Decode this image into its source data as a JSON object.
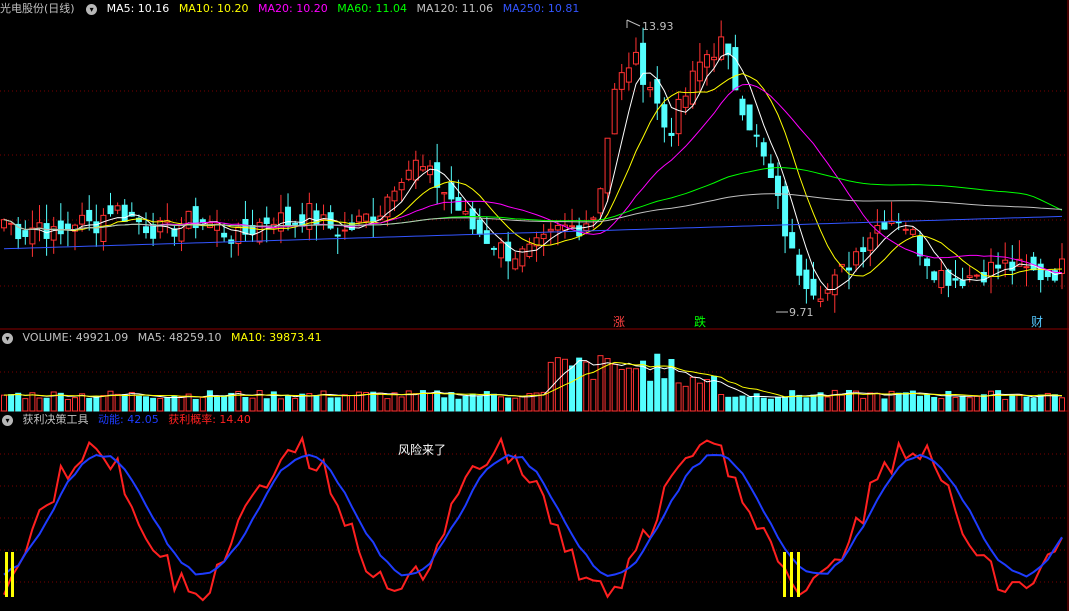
{
  "price_panel": {
    "title": "光电股份(日线)",
    "indicators": [
      {
        "label": "MA5: 10.16",
        "color": "#ffffff"
      },
      {
        "label": "MA10: 10.20",
        "color": "#ffff00"
      },
      {
        "label": "MA20: 10.20",
        "color": "#ff00ff"
      },
      {
        "label": "MA60: 11.04",
        "color": "#00ff00"
      },
      {
        "label": "MA120: 11.06",
        "color": "#c0c0c0"
      },
      {
        "label": "MA250: 10.81",
        "color": "#3355ff"
      }
    ],
    "high_label": "13.93",
    "low_label": "9.71",
    "markers": [
      "涨",
      "跌",
      "财"
    ]
  },
  "volume_panel": {
    "title": "VOLUME: 49921.09",
    "ma5": "MA5: 48259.10",
    "ma10": "MA10: 39873.41"
  },
  "indicator_panel": {
    "title": "获利决策工具",
    "momentum": "动能: 42.05",
    "probability": "获利概率: 14.40",
    "annotation": "风险来了"
  },
  "colors": {
    "up": "#ff3232",
    "down": "#54ffff",
    "ma5": "#ffffff",
    "ma10": "#ffff00",
    "ma20": "#ff00ff",
    "ma60": "#00ff00",
    "ma120": "#c0c0c0",
    "ma250": "#3355ff",
    "momentum": "#1e3cff",
    "probability": "#ff2020",
    "grid": "#8b0000"
  },
  "chart_data": {
    "type": "candlestick",
    "high": 13.93,
    "low": 9.71,
    "close_path": [
      10.9,
      10.7,
      10.85,
      10.6,
      10.9,
      10.8,
      11.1,
      10.95,
      10.8,
      10.7,
      10.85,
      10.9,
      10.75,
      10.6,
      10.8,
      10.95,
      10.85,
      11.0,
      10.8,
      10.7,
      10.9,
      11.05,
      11.6,
      11.75,
      11.5,
      11.2,
      10.8,
      10.6,
      10.4,
      10.35,
      10.5,
      10.75,
      10.8,
      11.0,
      12.8,
      13.4,
      13.0,
      12.2,
      12.8,
      13.4,
      13.6,
      12.8,
      12.1,
      11.3,
      10.3,
      9.9,
      9.8,
      10.2,
      10.6,
      10.9,
      10.95,
      10.5,
      10.1,
      10.0,
      10.05,
      10.15,
      10.2,
      10.1,
      10.05,
      10.16
    ]
  }
}
